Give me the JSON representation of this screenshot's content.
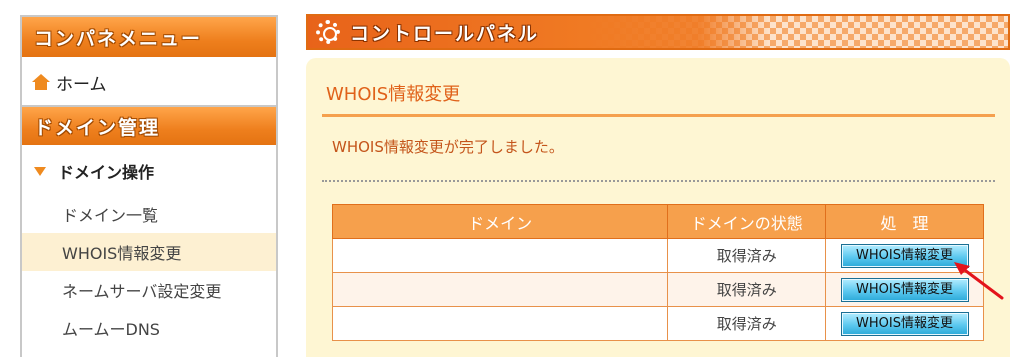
{
  "sidebar": {
    "header_menu": "コンパネメニュー",
    "home_label": "ホーム",
    "header_domain": "ドメイン管理",
    "group_label": "ドメイン操作",
    "items": [
      {
        "label": "ドメイン一覧",
        "active": false
      },
      {
        "label": "WHOIS情報変更",
        "active": true
      },
      {
        "label": "ネームサーバ設定変更",
        "active": false
      },
      {
        "label": "ムームーDNS",
        "active": false
      }
    ]
  },
  "main": {
    "title": "コントロールパネル",
    "section_title": "WHOIS情報変更",
    "message": "WHOIS情報変更が完了しました。",
    "table": {
      "headers": [
        "ドメイン",
        "ドメインの状態",
        "処　理"
      ],
      "rows": [
        {
          "domain": "",
          "status": "取得済み",
          "action": "WHOIS情報変更"
        },
        {
          "domain": "",
          "status": "取得済み",
          "action": "WHOIS情報変更"
        },
        {
          "domain": "",
          "status": "取得済み",
          "action": "WHOIS情報変更"
        }
      ]
    }
  },
  "colors": {
    "accent_orange": "#ef8a1f",
    "panel_bg": "#fef6d3",
    "button_blue": "#5cc8ef",
    "annotation_red": "#e3131b"
  },
  "icons": [
    "home-icon",
    "gear-icon",
    "triangle-down-icon",
    "red-arrow-annotation"
  ]
}
